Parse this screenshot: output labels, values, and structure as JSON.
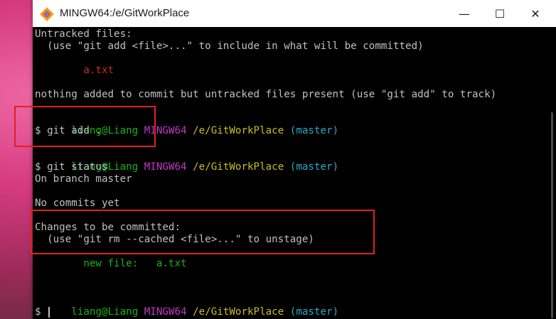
{
  "window": {
    "title": "MINGW64:/e/GitWorkPlace",
    "minimize_glyph": "—",
    "maximize_glyph": "☐",
    "close_glyph": "✕",
    "app_icon": "git-bash-icon"
  },
  "terminal": {
    "line1": "Untracked files:",
    "line2": "  (use \"git add <file>...\" to include in what will be committed)",
    "line3_file": "        a.txt",
    "line4": "nothing added to commit but untracked files present (use \"git add\" to track)",
    "prompt1": {
      "user": "liang@Liang",
      "sys": "MINGW64",
      "path": "/e/GitWorkPlace",
      "branch": "(master)"
    },
    "cmd1": "$ git add .",
    "prompt2": {
      "user": "liang@Liang",
      "sys": "MINGW64",
      "path": "/e/GitWorkPlace",
      "branch": "(master)"
    },
    "cmd2": "$ git status",
    "out1": "On branch master",
    "out2": "No commits yet",
    "out3": "Changes to be committed:",
    "out4": "  (use \"git rm --cached <file>...\" to unstage)",
    "out5": "        new file:   a.txt",
    "prompt3": {
      "user": "liang@Liang",
      "sys": "MINGW64",
      "path": "/e/GitWorkPlace",
      "branch": "(master)"
    },
    "cmd3": "$ "
  },
  "colors": {
    "user": "#18b218",
    "system": "#c038c8",
    "path": "#c8bf20",
    "branch": "#2aa9c8",
    "untracked": "#cc2a2a",
    "highlight_box": "#e02020"
  }
}
